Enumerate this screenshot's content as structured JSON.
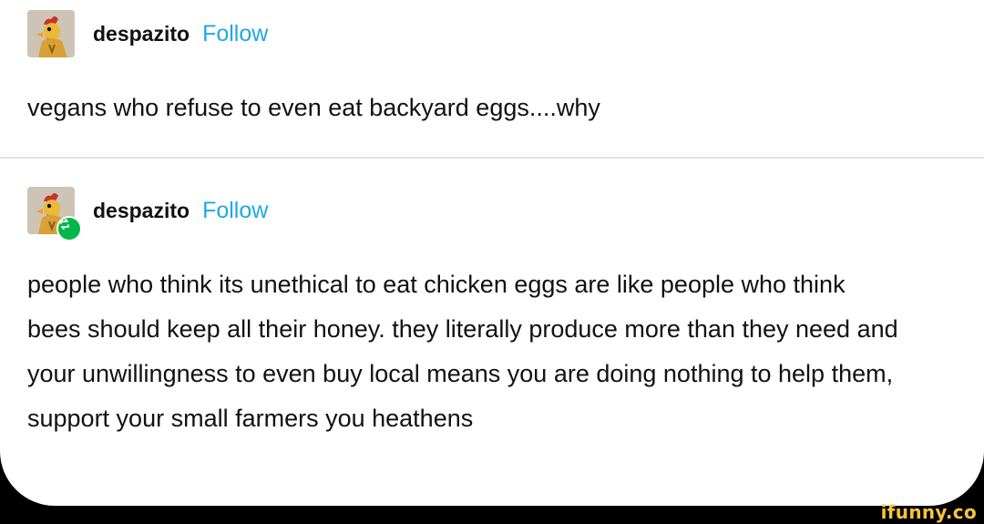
{
  "posts": [
    {
      "username": "despazito",
      "follow_label": "Follow",
      "is_reblog": false,
      "text": "vegans who refuse to even eat backyard eggs....why"
    },
    {
      "username": "despazito",
      "follow_label": "Follow",
      "is_reblog": true,
      "text": "people who think its unethical to eat chicken eggs are like people who think bees should keep all their honey. they literally produce more than they need and your unwillingness to even buy local means you are doing nothing to help them, support your small farmers you heathens"
    }
  ],
  "watermark": "ifunny.co",
  "colors": {
    "follow": "#1ea8e6",
    "reblog_badge": "#00b84a",
    "watermark": "#f6c43a",
    "background": "#000000",
    "card": "#ffffff"
  },
  "icons": {
    "avatar": "chicken-avatar-icon",
    "reblog": "reblog-icon"
  }
}
